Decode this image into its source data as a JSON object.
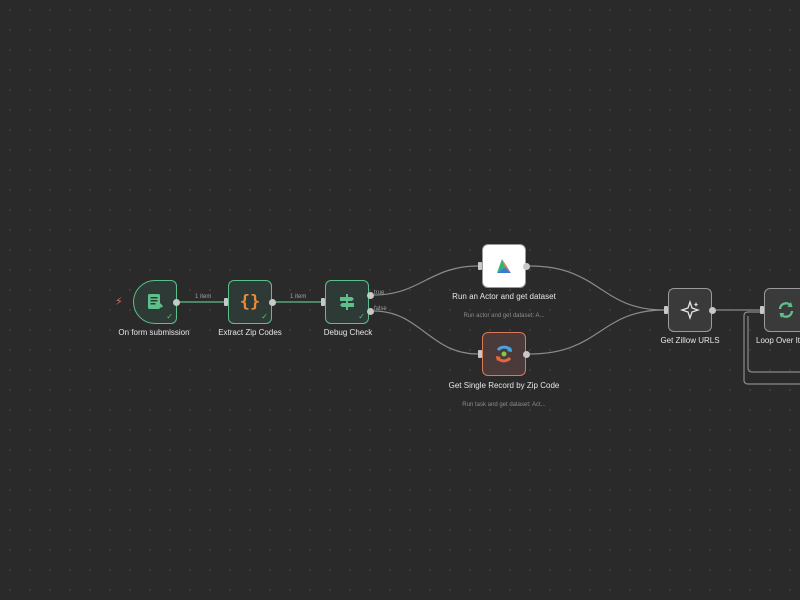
{
  "nodes": {
    "form_trigger": {
      "label": "On form submission",
      "icon": "form-icon",
      "status": "success"
    },
    "extract_zip": {
      "label": "Extract Zip Codes",
      "icon": "curly-braces-icon",
      "status": "success"
    },
    "debug_check": {
      "label": "Debug Check",
      "icon": "signpost-icon",
      "status": "success"
    },
    "run_actor": {
      "label": "Run an Actor and get dataset",
      "sublabel": "Run actor and get dataset: A...",
      "icon": "apify-icon"
    },
    "single_record": {
      "label": "Get Single Record by Zip Code",
      "sublabel": "Run task and get dataset: Act...",
      "icon": "refresh-colorful-icon"
    },
    "zillow_urls": {
      "label": "Get Zillow URLS",
      "icon": "sparkles-icon"
    },
    "loop_over": {
      "label": "Loop Over It",
      "icon": "loop-icon"
    }
  },
  "edges": {
    "e1_label": "1 item",
    "e2_label": "1 item",
    "true_label": "true",
    "false_label": "false"
  },
  "colors": {
    "canvas_bg": "#2a2a2a",
    "success_green": "#5fbf8a",
    "trigger_red": "#e06850",
    "code_orange": "#e8893c"
  }
}
